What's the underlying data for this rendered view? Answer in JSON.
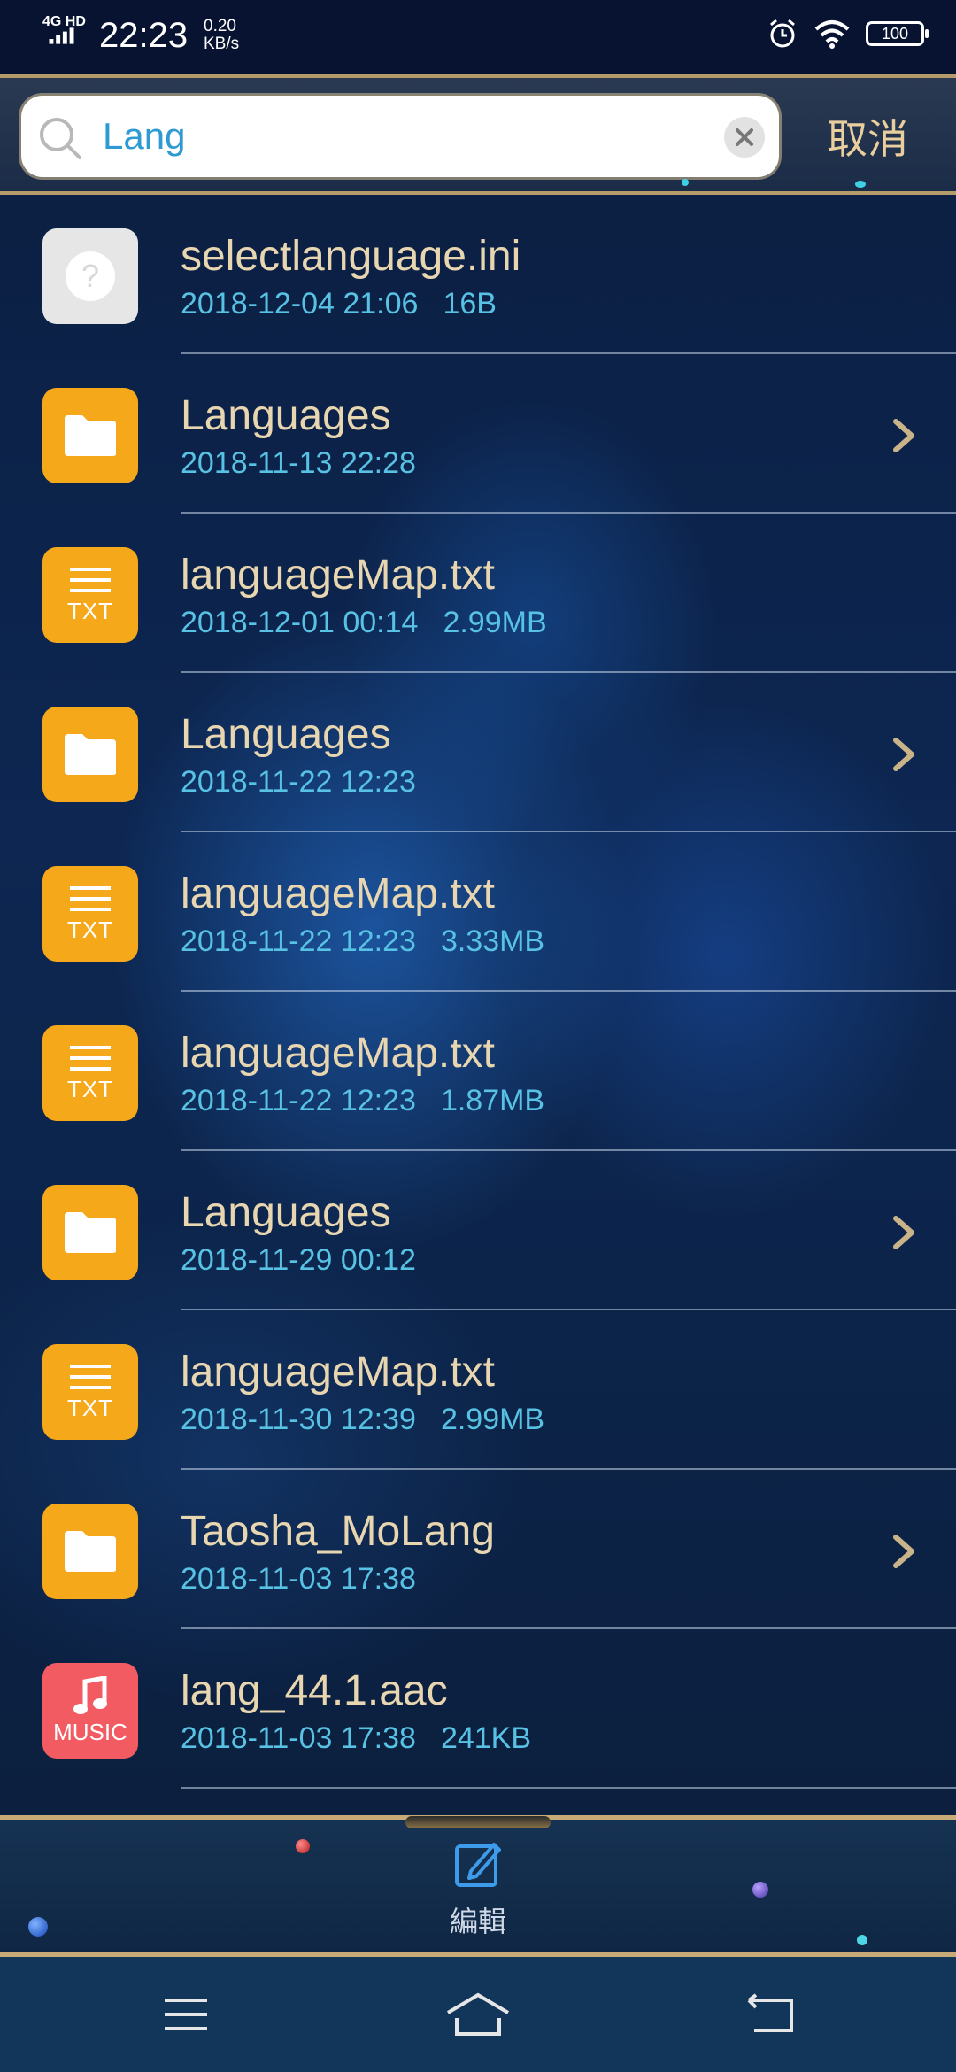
{
  "status_bar": {
    "network": "4G HD",
    "time": "22:23",
    "speed_value": "0.20",
    "speed_unit": "KB/s",
    "battery": "100"
  },
  "search": {
    "query": "Lang",
    "cancel_label": "取消"
  },
  "files": [
    {
      "type": "unknown",
      "name": "selectlanguage.ini",
      "date": "2018-12-04 21:06",
      "size": "16B",
      "is_folder": false
    },
    {
      "type": "folder",
      "name": "Languages",
      "date": "2018-11-13 22:28",
      "size": "",
      "is_folder": true
    },
    {
      "type": "txt",
      "name": "languageMap.txt",
      "date": "2018-12-01 00:14",
      "size": "2.99MB",
      "is_folder": false
    },
    {
      "type": "folder",
      "name": "Languages",
      "date": "2018-11-22 12:23",
      "size": "",
      "is_folder": true
    },
    {
      "type": "txt",
      "name": "languageMap.txt",
      "date": "2018-11-22 12:23",
      "size": "3.33MB",
      "is_folder": false
    },
    {
      "type": "txt",
      "name": "languageMap.txt",
      "date": "2018-11-22 12:23",
      "size": "1.87MB",
      "is_folder": false
    },
    {
      "type": "folder",
      "name": "Languages",
      "date": "2018-11-29 00:12",
      "size": "",
      "is_folder": true
    },
    {
      "type": "txt",
      "name": "languageMap.txt",
      "date": "2018-11-30 12:39",
      "size": "2.99MB",
      "is_folder": false
    },
    {
      "type": "folder",
      "name": "Taosha_MoLang",
      "date": "2018-11-03 17:38",
      "size": "",
      "is_folder": true
    },
    {
      "type": "music",
      "name": "lang_44.1.aac",
      "date": "2018-11-03 17:38",
      "size": "241KB",
      "is_folder": false
    }
  ],
  "icon_labels": {
    "txt": "TXT",
    "music": "MUSIC"
  },
  "toolbar": {
    "edit_label": "編輯"
  },
  "colors": {
    "accent_gold": "#e8d6b0",
    "accent_cyan": "#58c2e4",
    "folder_orange": "#f6a81b",
    "music_red": "#f15b61"
  }
}
